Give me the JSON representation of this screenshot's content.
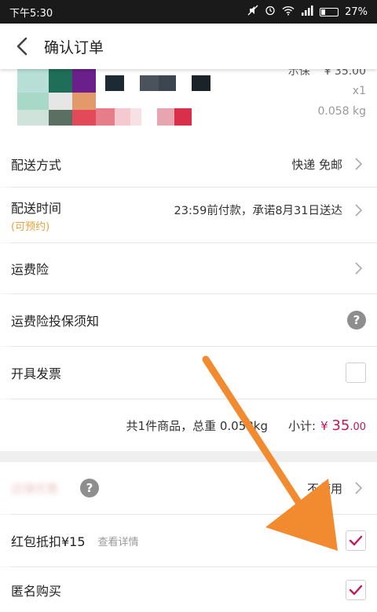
{
  "status_bar": {
    "time": "下午5:30",
    "battery": "27%",
    "battery_level": 0.27
  },
  "header": {
    "title": "确认订单"
  },
  "product": {
    "spec": "示保",
    "price": "¥ 35.00",
    "quantity": "x1",
    "weight": "0.058 kg"
  },
  "delivery": {
    "label": "配送方式",
    "value": "快递 免邮"
  },
  "delivery_time": {
    "label": "配送时间",
    "sub": "(可预约)",
    "value": "23:59前付款，承诺8月31日送达"
  },
  "shipping_insurance": {
    "label": "运费险"
  },
  "insurance_notice": {
    "label": "运费险投保须知"
  },
  "invoice": {
    "label": "开具发票",
    "checked": false
  },
  "summary": {
    "count_weight": "共1件商品，总重 0.058kg",
    "subtotal_label": "小计:",
    "currency": "¥",
    "amount_int": "35",
    "amount_dec": ".00"
  },
  "coupon": {
    "label": "店铺优惠",
    "value": "不使用"
  },
  "red_packet": {
    "label": "红包抵扣¥15",
    "detail_link": "查看详情",
    "checked": true
  },
  "anonymous": {
    "label": "匿名购买",
    "checked": true
  },
  "colors": {
    "accent": "#c2185b",
    "arrow": "#f28a30",
    "sub_orange": "#e6a23c"
  }
}
